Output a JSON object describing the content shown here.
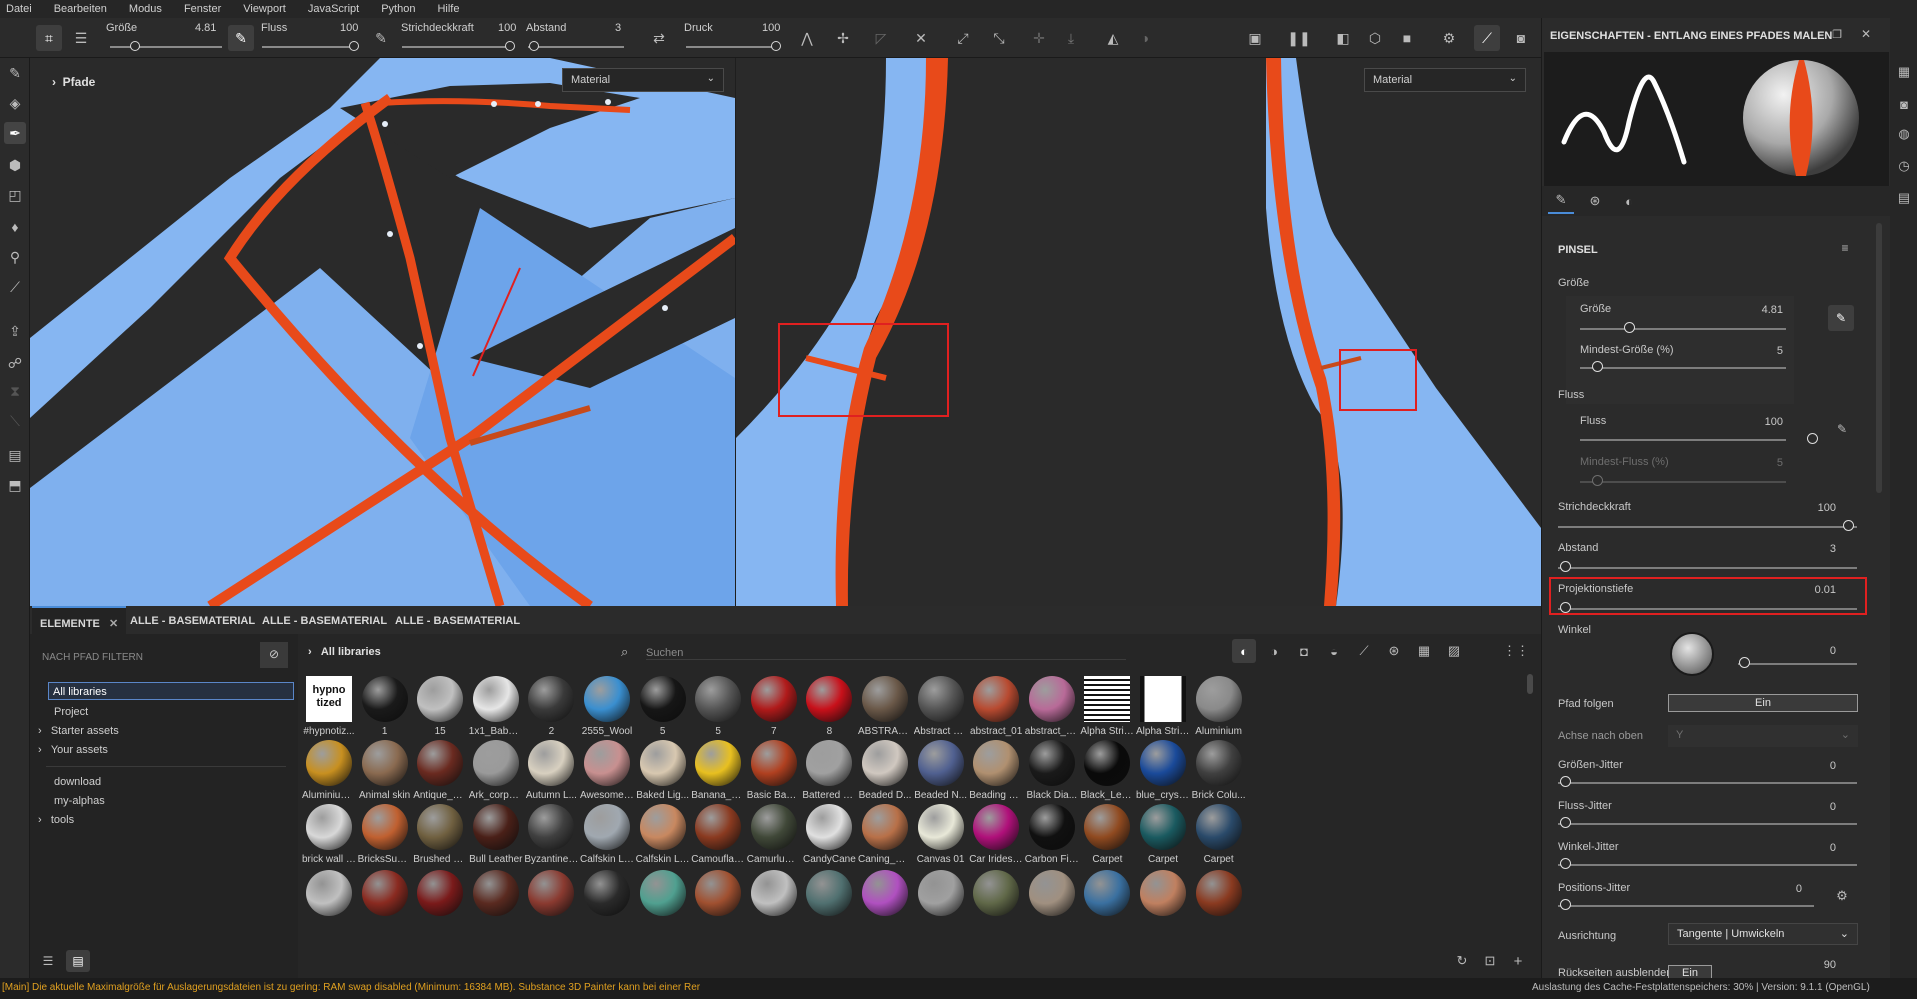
{
  "menu": [
    "Datei",
    "Bearbeiten",
    "Modus",
    "Fenster",
    "Viewport",
    "JavaScript",
    "Python",
    "Hilfe"
  ],
  "toolbar": {
    "size_label": "Größe",
    "size_value": "4.81",
    "flow_label": "Fluss",
    "flow_value": "100",
    "stroke_label": "Strichdeckkraft",
    "stroke_value": "100",
    "spacing_label": "Abstand",
    "spacing_value": "3",
    "pressure_label": "Druck",
    "pressure_value": "100"
  },
  "viewport": {
    "paths_label": "Pfade",
    "material_left": "Material",
    "material_right": "Material"
  },
  "properties": {
    "title": "EIGENSCHAFTEN - ENTLANG EINES PFADES MALEN",
    "section": "PINSEL",
    "groesse_group": "Größe",
    "groesse_label": "Größe",
    "groesse_value": "4.81",
    "min_groesse_label": "Mindest-Größe (%)",
    "min_groesse_value": "5",
    "fluss_group": "Fluss",
    "fluss_label": "Fluss",
    "fluss_value": "100",
    "min_fluss_label": "Mindest-Fluss (%)",
    "min_fluss_value": "5",
    "strich_label": "Strichdeckkraft",
    "strich_value": "100",
    "abstand_label": "Abstand",
    "abstand_value": "3",
    "proj_label": "Projektionstiefe",
    "proj_value": "0.01",
    "winkel_label": "Winkel",
    "winkel_value": "0",
    "pfad_label": "Pfad folgen",
    "pfad_value": "Ein",
    "achse_label": "Achse nach oben",
    "achse_value": "Y",
    "gj_label": "Größen-Jitter",
    "gj_value": "0",
    "fj_label": "Fluss-Jitter",
    "fj_value": "0",
    "wj_label": "Winkel-Jitter",
    "wj_value": "0",
    "pj_label": "Positions-Jitter",
    "pj_value": "0",
    "ausr_label": "Ausrichtung",
    "ausr_value": "Tangente | Umwickeln",
    "rueck_label": "Rückseiten ausblenden",
    "rueck_value": "Ein",
    "rueck_num": "90"
  },
  "assets_panel": {
    "tabs": [
      "ELEMENTE",
      "ALLE - BASEMATERIAL",
      "ALLE - BASEMATERIAL",
      "ALLE - BASEMATERIAL"
    ],
    "filter_placeholder": "NACH PFAD FILTERN",
    "tree": [
      "All libraries",
      "Project",
      "Starter assets",
      "Your assets",
      "download",
      "my-alphas",
      "tools"
    ],
    "breadcrumb": "All libraries",
    "search_placeholder": "Suchen",
    "row1": [
      "#hypnotiz...",
      "1",
      "15",
      "1x1_Baby_...",
      "2",
      "2555_Wool",
      "5",
      "5",
      "7",
      "8",
      "ABSTRACT ...",
      "Abstract W...",
      "abstract_01",
      "abstract_p...",
      "Alpha Strip...",
      "Alpha Strip...",
      "Aluminium"
    ],
    "row2": [
      "Aluminium...",
      "Animal skin",
      "Antique_W...",
      "Ark_corp_fl...",
      "Autumn L...",
      "AwesomeF...",
      "Baked Lig...",
      "Banana_Sk...",
      "Basic Band...",
      "Battered Ni...",
      "Beaded D...",
      "Beaded N...",
      "Beading H...",
      "Black Dia...",
      "Black_Leat...",
      "blue_crysta...",
      "Brick Colu..."
    ],
    "row3": [
      "brick wall 0...",
      "BricksSubs...",
      "Brushed G...",
      "Bull Leather",
      "Byzantine ...",
      "Calfskin Le...",
      "Calfskin Le...",
      "Camouflag...",
      "CamurluAlan",
      "CandyCane",
      "Caning_we...",
      "Canvas 01",
      "Car Iridesc...",
      "Carbon Fiber",
      "Carpet",
      "Carpet",
      "Carpet"
    ],
    "hypno_text": "hypno\ntized"
  },
  "status": {
    "left": "[Main] Die aktuelle Maximalgröße für Auslagerungsdateien ist zu gering: RAM swap disabled (Minimum: 16384 MB). Substance 3D Painter kann bei einer Rer",
    "right": "Auslastung des Cache-Festplattenspeichers: 30% | Version: 9.1.1 (OpenGL)"
  },
  "colors": {
    "accent": "#e84a1a",
    "highlight": "#e02020",
    "sky": "#8cb8f0"
  }
}
